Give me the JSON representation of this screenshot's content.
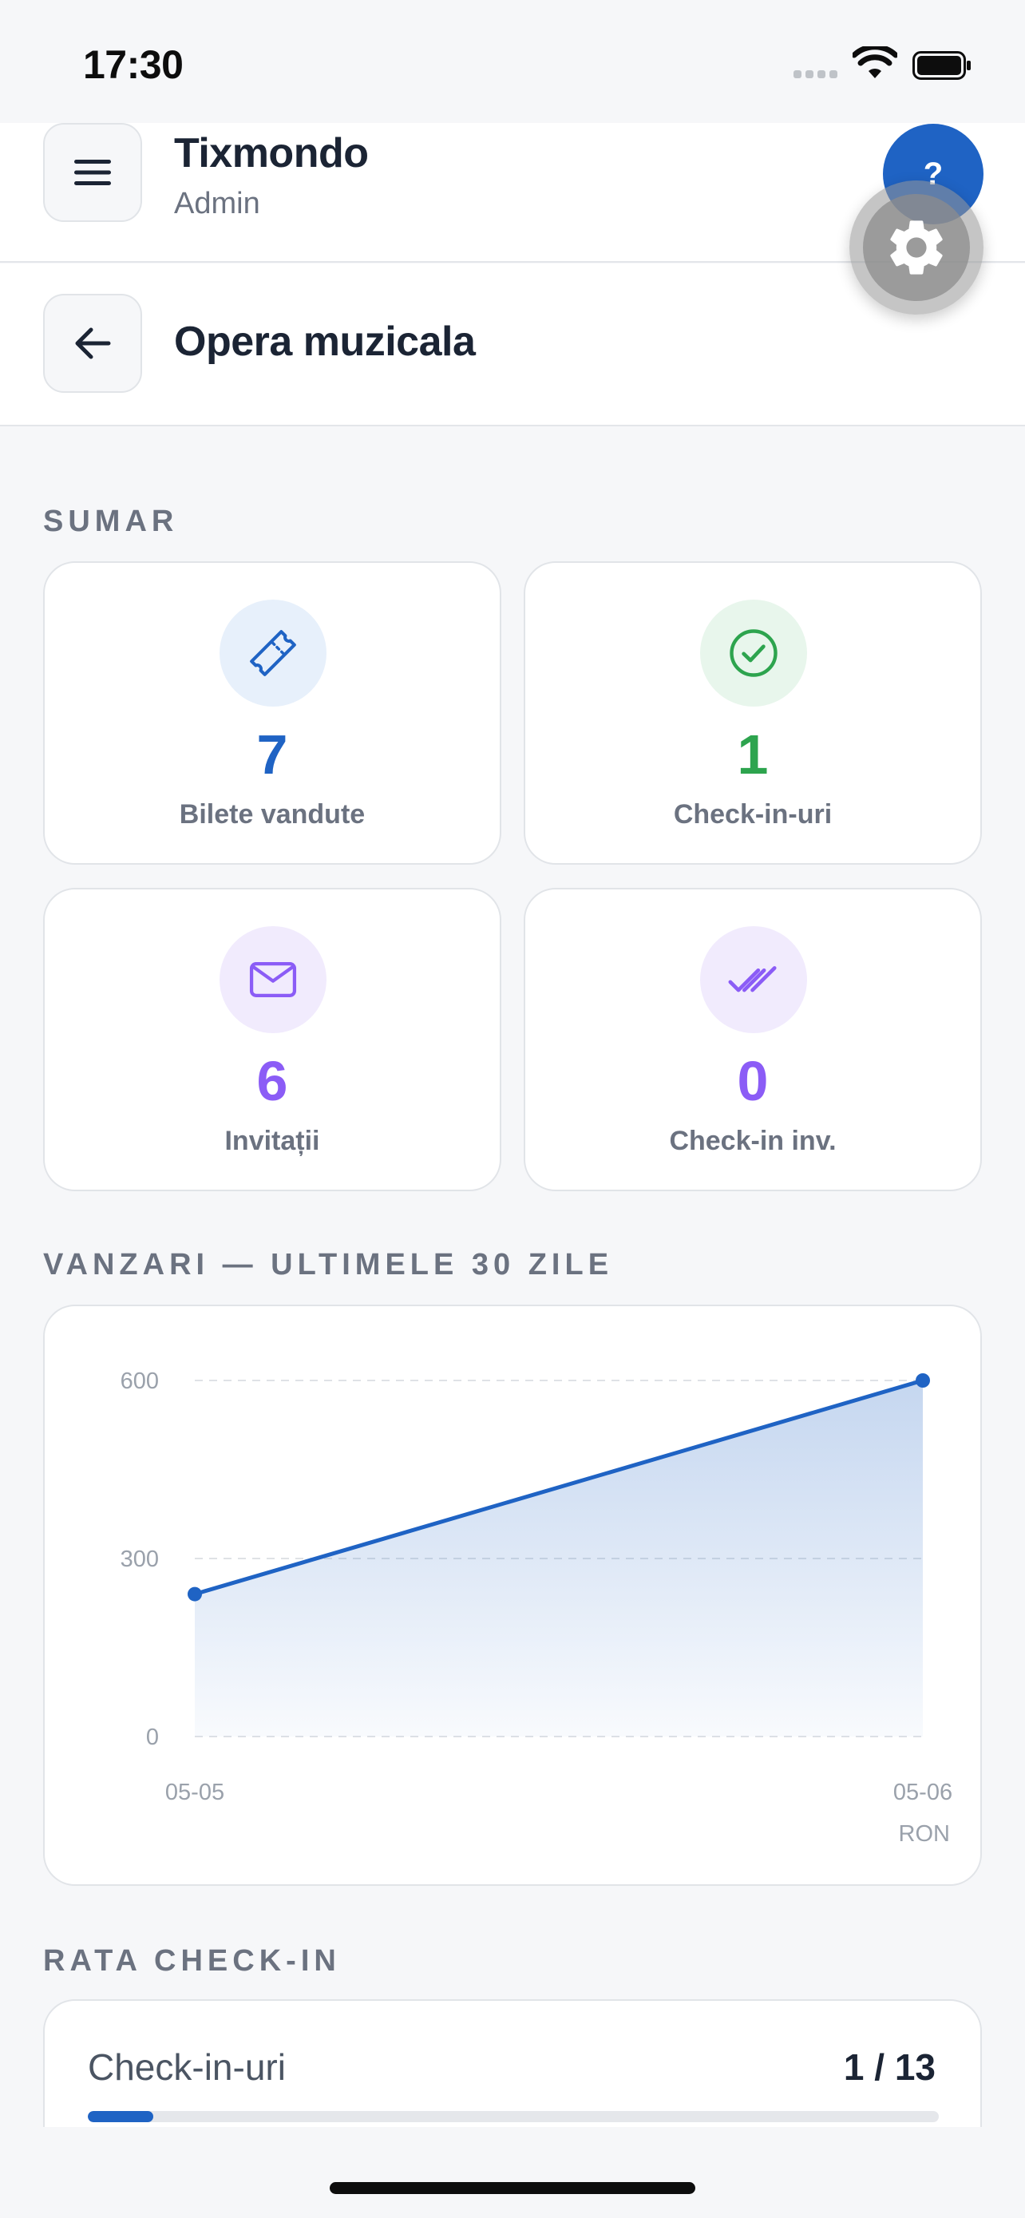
{
  "status_bar": {
    "time": "17:30"
  },
  "app_header": {
    "title": "Tixmondo",
    "subtitle": "Admin"
  },
  "page_header": {
    "title": "Opera muzicala"
  },
  "help_button": {
    "label": "?"
  },
  "summary": {
    "label": "SUMAR",
    "cards": [
      {
        "value": "7",
        "label": "Bilete vandute",
        "icon": "ticket-icon",
        "color": "#1f63c4",
        "bg": "#e7f0fb"
      },
      {
        "value": "1",
        "label": "Check-in-uri",
        "icon": "check-circle-icon",
        "color": "#2da44e",
        "bg": "#e8f6ec"
      },
      {
        "value": "6",
        "label": "Invitații",
        "icon": "envelope-icon",
        "color": "#8b5cf6",
        "bg": "#f1ebfd"
      },
      {
        "value": "0",
        "label": "Check-in inv.",
        "icon": "double-check-icon",
        "color": "#8b5cf6",
        "bg": "#f1ebfd"
      }
    ]
  },
  "sales": {
    "label": "VANZARI — ULTIMELE 30 ZILE",
    "unit": "RON"
  },
  "chart_data": {
    "type": "area",
    "x": [
      "05-05",
      "05-06"
    ],
    "values": [
      240,
      600
    ],
    "ylim": [
      0,
      600
    ],
    "yticks": [
      0,
      300,
      600
    ],
    "ytick_labels": [
      "0",
      "300",
      "600"
    ],
    "grid": true,
    "color": "#1f63c4"
  },
  "checkin_rate": {
    "label": "RATA CHECK-IN",
    "row_label": "Check-in-uri",
    "value_text": "1 / 13",
    "checked": 1,
    "total": 13
  }
}
